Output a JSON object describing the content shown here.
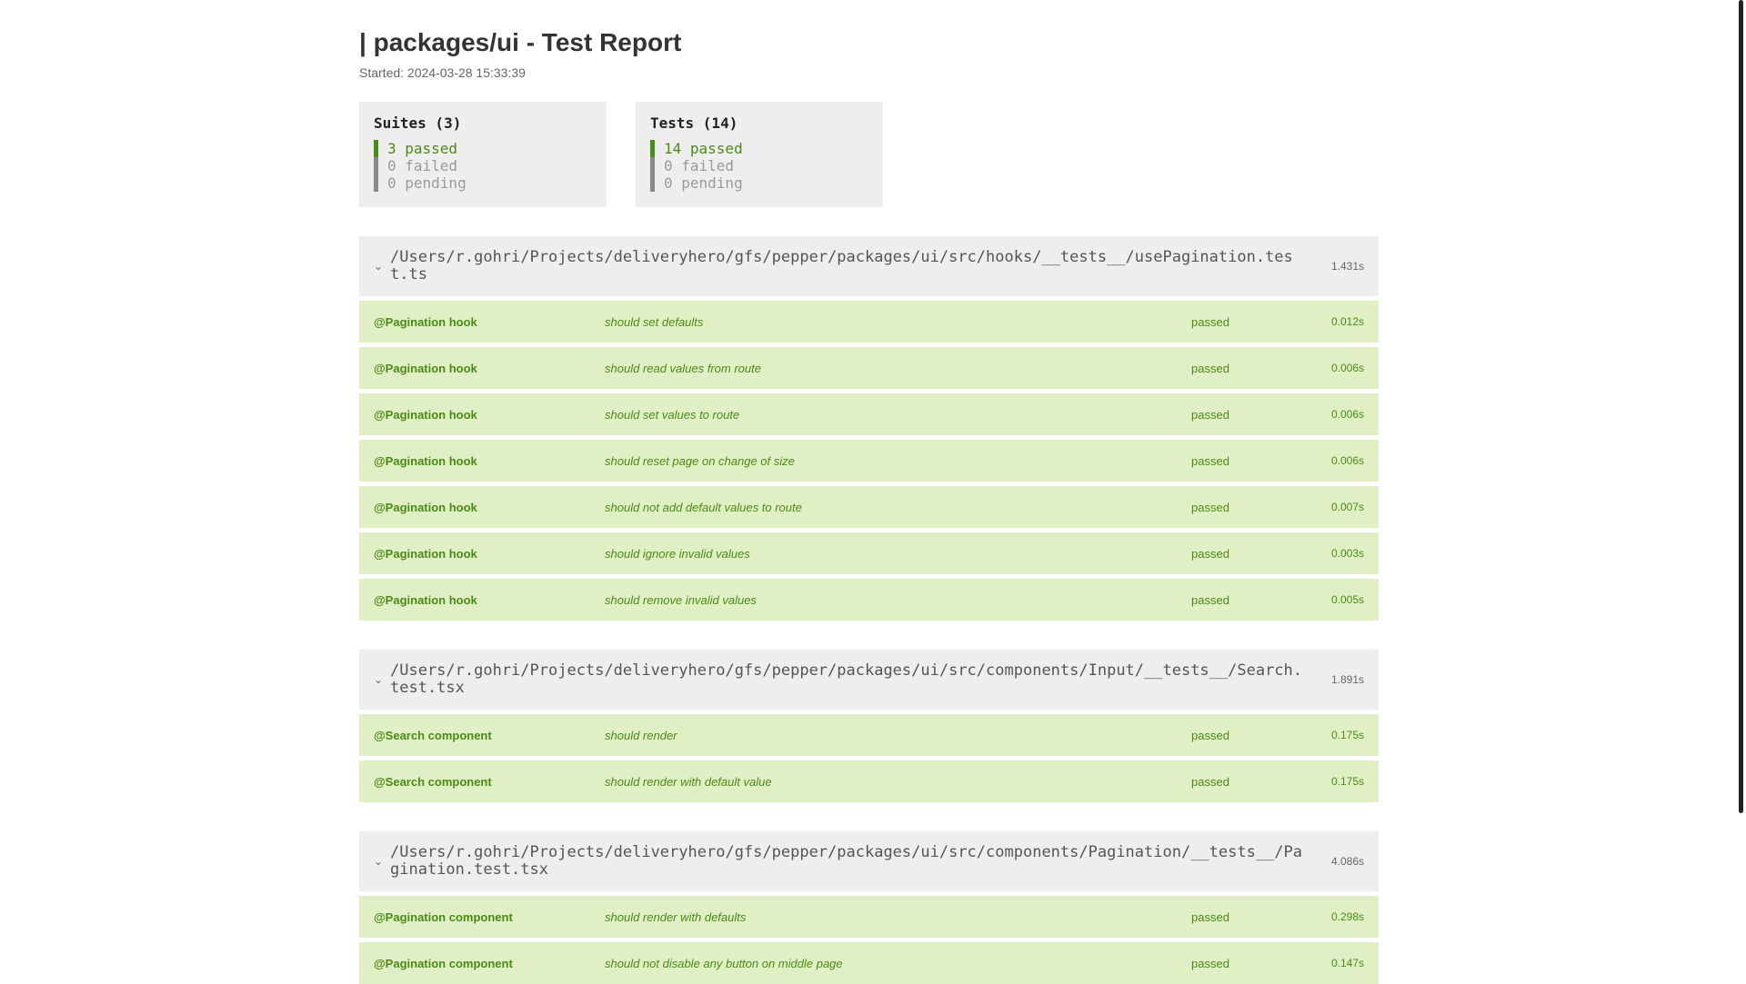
{
  "report": {
    "title": "| packages/ui - Test Report",
    "started": "Started: 2024-03-28 15:33:39"
  },
  "summary": {
    "suites": {
      "title": "Suites (3)",
      "passed": "3 passed",
      "failed": "0 failed",
      "pending": "0 pending"
    },
    "tests": {
      "title": "Tests (14)",
      "passed": "14 passed",
      "failed": "0 failed",
      "pending": "0 pending"
    }
  },
  "colors": {
    "passed": "#4a8a16",
    "row_bg": "#e1f0c4",
    "header_bg": "#eeeeee"
  },
  "suites": [
    {
      "icon": "chevron-down-icon",
      "path": "/Users/r.gohri/Projects/deliveryhero/gfs/pepper/packages/ui/src/hooks/__tests__/usePagination.test.ts",
      "time": "1.431s",
      "tests": [
        {
          "suite": "@Pagination hook",
          "name": "should set defaults",
          "status": "passed",
          "time": "0.012s"
        },
        {
          "suite": "@Pagination hook",
          "name": "should read values from route",
          "status": "passed",
          "time": "0.006s"
        },
        {
          "suite": "@Pagination hook",
          "name": "should set values to route",
          "status": "passed",
          "time": "0.006s"
        },
        {
          "suite": "@Pagination hook",
          "name": "should reset page on change of size",
          "status": "passed",
          "time": "0.006s"
        },
        {
          "suite": "@Pagination hook",
          "name": "should not add default values to route",
          "status": "passed",
          "time": "0.007s"
        },
        {
          "suite": "@Pagination hook",
          "name": "should ignore invalid values",
          "status": "passed",
          "time": "0.003s"
        },
        {
          "suite": "@Pagination hook",
          "name": "should remove invalid values",
          "status": "passed",
          "time": "0.005s"
        }
      ]
    },
    {
      "icon": "chevron-down-icon",
      "path": "/Users/r.gohri/Projects/deliveryhero/gfs/pepper/packages/ui/src/components/Input/__tests__/Search.test.tsx",
      "time": "1.891s",
      "tests": [
        {
          "suite": "@Search component",
          "name": "should render",
          "status": "passed",
          "time": "0.175s"
        },
        {
          "suite": "@Search component",
          "name": "should render with default value",
          "status": "passed",
          "time": "0.175s"
        }
      ]
    },
    {
      "icon": "chevron-down-icon",
      "path": "/Users/r.gohri/Projects/deliveryhero/gfs/pepper/packages/ui/src/components/Pagination/__tests__/Pagination.test.tsx",
      "time": "4.086s",
      "tests": [
        {
          "suite": "@Pagination component",
          "name": "should render with defaults",
          "status": "passed",
          "time": "0.298s"
        },
        {
          "suite": "@Pagination component",
          "name": "should not disable any button on middle page",
          "status": "passed",
          "time": "0.147s"
        }
      ]
    }
  ]
}
